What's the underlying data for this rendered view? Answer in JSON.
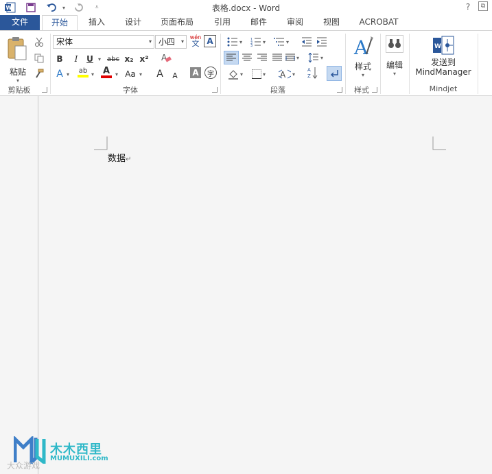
{
  "window": {
    "title": "表格.docx - Word",
    "help": "?",
    "restore": "⧉"
  },
  "qat": {
    "app_icon": "word-icon",
    "save_icon": "save-icon",
    "undo_icon": "undo-icon",
    "redo_icon": "redo-icon",
    "customize_icon": "customize-qat-icon"
  },
  "tabs": {
    "file": "文件",
    "home": "开始",
    "insert": "插入",
    "design": "设计",
    "layout": "页面布局",
    "references": "引用",
    "mailings": "邮件",
    "review": "审阅",
    "view": "视图",
    "acrobat": "ACROBAT"
  },
  "ribbon": {
    "clipboard": {
      "paste_label": "粘贴",
      "group_label": "剪贴板"
    },
    "font": {
      "font_name": "宋体",
      "font_size": "小四",
      "wen_label": "wén",
      "wen_char": "文",
      "bold": "B",
      "italic": "I",
      "underline": "U",
      "strike": "abc",
      "subscript": "x₂",
      "superscript": "x²",
      "grow": "A",
      "shrink": "A",
      "case": "Aa",
      "char_shade": "A",
      "enclose": "字",
      "font_color": "A",
      "highlight": "ab",
      "group_label": "字体"
    },
    "paragraph": {
      "group_label": "段落"
    },
    "styles": {
      "styles_label": "样式",
      "group_label": "样式"
    },
    "editing": {
      "edit_label": "编辑"
    },
    "mindjet": {
      "send_label_1": "发送到",
      "send_label_2": "MindManager",
      "group_label": "Mindjet"
    }
  },
  "document": {
    "text": "数据"
  },
  "watermark": {
    "cn": "木木西里",
    "en": "MUMUXILI.com",
    "bottom": "大众游戏"
  },
  "colors": {
    "accent": "#2b579a",
    "highlight": "#ffff00",
    "font_color": "#e00000",
    "watermark": "#2fb8c8"
  }
}
